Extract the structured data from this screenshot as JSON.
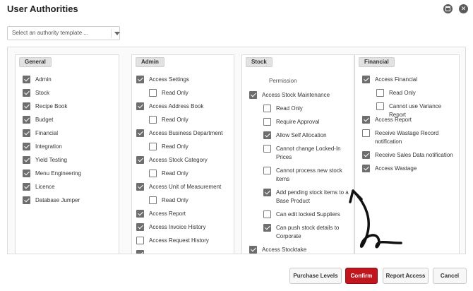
{
  "window": {
    "title": "User Authorities"
  },
  "template_select": {
    "value": "Select an authority template ..."
  },
  "panels": {
    "general": {
      "label": "General",
      "items": [
        {
          "label": "Admin",
          "checked": true
        },
        {
          "label": "Stock",
          "checked": true
        },
        {
          "label": "Recipe Book",
          "checked": true
        },
        {
          "label": "Budget",
          "checked": true
        },
        {
          "label": "Financial",
          "checked": true
        },
        {
          "label": "Integration",
          "checked": true
        },
        {
          "label": "Yield Testing",
          "checked": true
        },
        {
          "label": "Menu Engineering",
          "checked": true
        },
        {
          "label": "Licence",
          "checked": true
        },
        {
          "label": "Database Jumper",
          "checked": true
        }
      ]
    },
    "admin": {
      "label": "Admin",
      "items": [
        {
          "label": "Access Settings",
          "checked": true
        },
        {
          "label": "Read Only",
          "checked": false
        },
        {
          "label": "Access Address Book",
          "checked": true
        },
        {
          "label": "Read Only",
          "checked": false
        },
        {
          "label": "Access Business Department",
          "checked": true
        },
        {
          "label": "Read Only",
          "checked": false
        },
        {
          "label": "Access Stock Category",
          "checked": true
        },
        {
          "label": "Read Only",
          "checked": false
        },
        {
          "label": "Access Unit of Measurement",
          "checked": true
        },
        {
          "label": "Read Only",
          "checked": false
        },
        {
          "label": "Access Report",
          "checked": true
        },
        {
          "label": "Access Invoice History",
          "checked": true
        },
        {
          "label": "Access Request History",
          "checked": false
        }
      ]
    },
    "stock": {
      "label": "Stock",
      "items": [
        {
          "label": "Permission",
          "checked": null
        },
        {
          "label": "Access Stock Maintenance",
          "checked": true
        },
        {
          "label": "Read Only",
          "checked": false
        },
        {
          "label": "Require Approval",
          "checked": false
        },
        {
          "label": "Allow Self Allocation",
          "checked": true
        },
        {
          "label": "Cannot change Locked-In Prices",
          "checked": false
        },
        {
          "label": "Cannot process new stock items",
          "checked": false
        },
        {
          "label": "Add pending stock items to a Base Product",
          "checked": true
        },
        {
          "label": "Can edit locked Suppliers",
          "checked": false
        },
        {
          "label": "Can push stock details to Corporate",
          "checked": true
        },
        {
          "label": "Access Stocktake",
          "checked": true
        }
      ]
    },
    "financial": {
      "label": "Financial",
      "items": [
        {
          "label": "Access Financial",
          "checked": true
        },
        {
          "label": "Read Only",
          "checked": false
        },
        {
          "label": "Cannot use Variance Report",
          "checked": false
        },
        {
          "label": "Access Report",
          "checked": true
        },
        {
          "label": "Receive Wastage Record notification",
          "checked": false
        },
        {
          "label": "Receive Sales Data notification",
          "checked": true
        },
        {
          "label": "Access Wastage",
          "checked": true
        }
      ]
    }
  },
  "footer": {
    "purchase_levels": "Purchase Levels",
    "confirm": "Confirm",
    "report_access": "Report Access",
    "cancel": "Cancel"
  },
  "colors": {
    "confirm_bg": "#c0161c",
    "checkbox_checked": "#6e6e6e"
  }
}
